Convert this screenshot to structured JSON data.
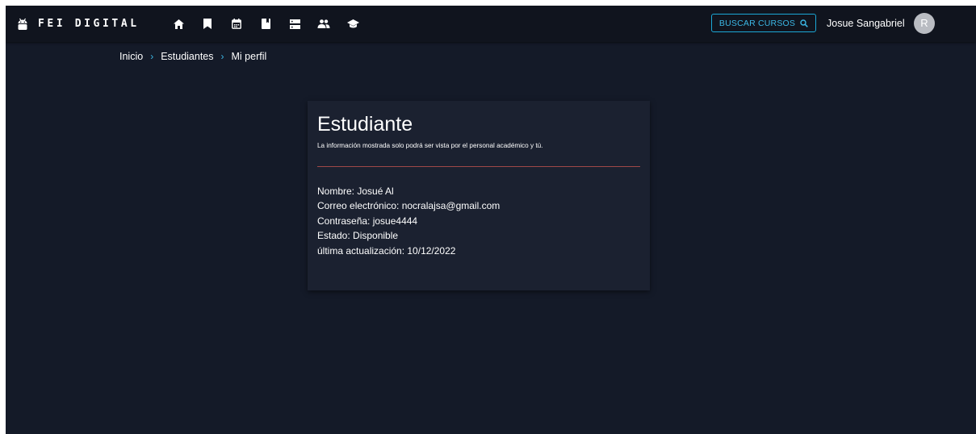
{
  "header": {
    "brand": "FEI DIGITAL",
    "nav_icons": [
      "home-icon",
      "bookmark-icon",
      "calendar-icon",
      "book-icon",
      "storage-icon",
      "people-icon",
      "school-icon"
    ],
    "search_button": "BUSCAR CURSOS",
    "user_name": "Josue Sangabriel",
    "avatar_letter": "R"
  },
  "breadcrumb": {
    "items": [
      "Inicio",
      "Estudiantes",
      "Mi perfil"
    ],
    "separator": "›"
  },
  "profile_card": {
    "title": "Estudiante",
    "subtitle": "La información mostrada solo podrá ser vista por el personal académico y tú.",
    "fields": [
      "Nombre: Josué Al",
      "Correo electrónico: nocralajsa@gmail.com",
      "Contraseña: josue4444",
      "Estado: Disponible",
      "última actualización: 10/12/2022"
    ]
  },
  "colors": {
    "background": "#141a28",
    "topbar": "#10141e",
    "card": "#1b2130",
    "accent": "#1ba7d6",
    "divider": "#a04848",
    "avatar": "#b9bcc2"
  }
}
